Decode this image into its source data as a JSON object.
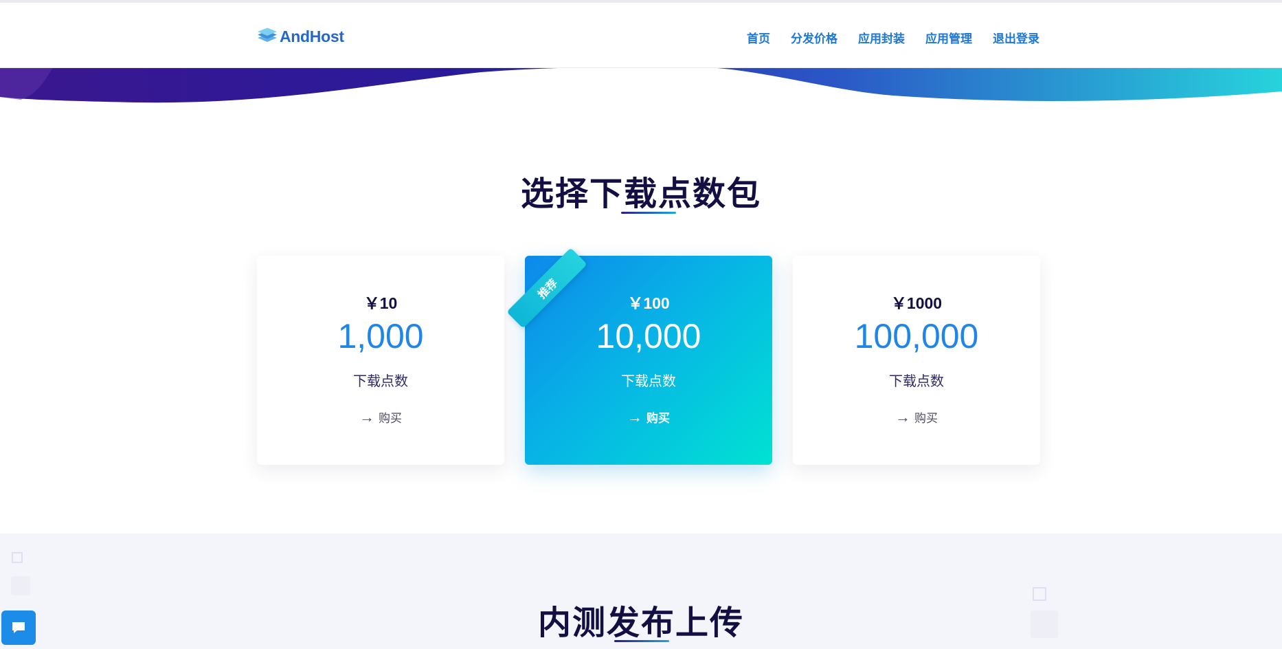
{
  "header": {
    "logo_text": "AndHost",
    "nav": [
      {
        "label": "首页"
      },
      {
        "label": "分发价格"
      },
      {
        "label": "应用封装"
      },
      {
        "label": "应用管理"
      },
      {
        "label": "退出登录"
      }
    ]
  },
  "pricing": {
    "title": "选择下载点数包",
    "plans": [
      {
        "price": "￥10",
        "points": "1,000",
        "unit": "下载点数",
        "buy_label": "购买",
        "featured": false
      },
      {
        "price": "￥100",
        "points": "10,000",
        "unit": "下载点数",
        "buy_label": "购买",
        "featured": true,
        "ribbon": "推荐"
      },
      {
        "price": "￥1000",
        "points": "100,000",
        "unit": "下载点数",
        "buy_label": "购买",
        "featured": false
      }
    ]
  },
  "beta": {
    "title": "内测发布上传"
  },
  "icons": {
    "buy_arrow": "arrow-right-icon",
    "chat": "chat-bubble-icon",
    "logo": "layers-logo-icon"
  },
  "colors": {
    "accent": "#1d77d6",
    "points": "#1f86e8",
    "title": "#140f42",
    "featured_gradient_start": "#0d89ea",
    "featured_gradient_end": "#00e2d2"
  }
}
